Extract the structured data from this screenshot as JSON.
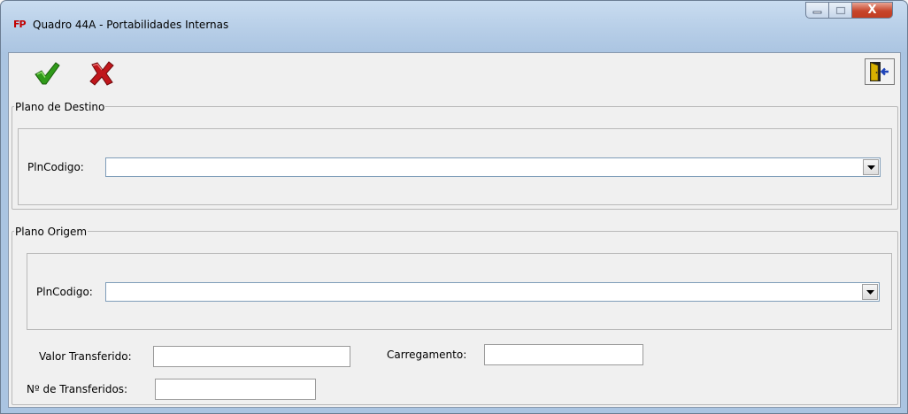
{
  "window": {
    "title": "Quadro 44A - Portabilidades Internas",
    "app_icon_text": "FP",
    "app_icon": "fp-app-icon",
    "close_glyph": "X"
  },
  "toolbar": {
    "confirm_icon": "green-check-icon",
    "cancel_icon": "red-x-icon",
    "exit_icon": "exit-door-icon"
  },
  "plano_destino": {
    "legend": "Plano de Destino",
    "pln_label": "PlnCodigo:",
    "pln_value": ""
  },
  "plano_origem": {
    "legend": "Plano Origem",
    "pln_label": "PlnCodigo:",
    "pln_value": "",
    "valor_label": "Valor Transferido:",
    "valor_value": "",
    "carregamento_label": "Carregamento:",
    "carregamento_value": "",
    "num_transferidos_label": "Nº de Transferidos:",
    "num_transferidos_value": ""
  },
  "colors": {
    "title_bg": "#b8cfe8",
    "close_red": "#c7452b",
    "check_green": "#2f9a19",
    "cancel_red": "#c0161b"
  }
}
